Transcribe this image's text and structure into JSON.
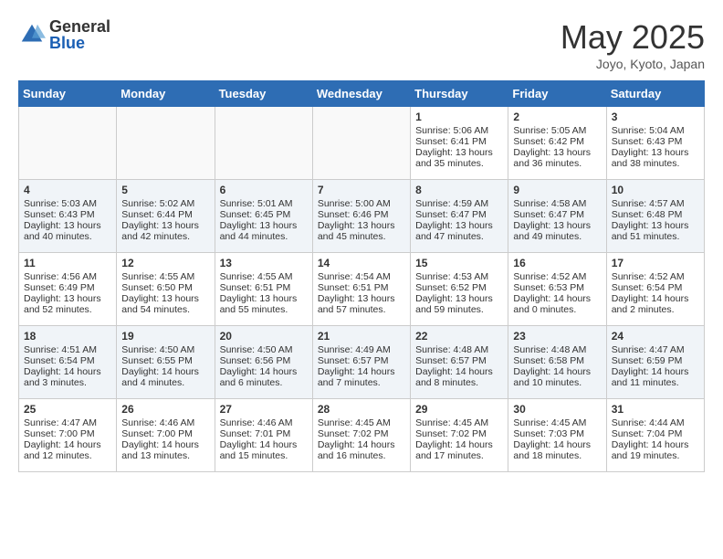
{
  "header": {
    "logo_general": "General",
    "logo_blue": "Blue",
    "month_title": "May 2025",
    "location": "Joyo, Kyoto, Japan"
  },
  "days_of_week": [
    "Sunday",
    "Monday",
    "Tuesday",
    "Wednesday",
    "Thursday",
    "Friday",
    "Saturday"
  ],
  "weeks": [
    [
      {
        "day": "",
        "empty": true
      },
      {
        "day": "",
        "empty": true
      },
      {
        "day": "",
        "empty": true
      },
      {
        "day": "",
        "empty": true
      },
      {
        "day": "1",
        "sunrise": "Sunrise: 5:06 AM",
        "sunset": "Sunset: 6:41 PM",
        "daylight": "Daylight: 13 hours and 35 minutes."
      },
      {
        "day": "2",
        "sunrise": "Sunrise: 5:05 AM",
        "sunset": "Sunset: 6:42 PM",
        "daylight": "Daylight: 13 hours and 36 minutes."
      },
      {
        "day": "3",
        "sunrise": "Sunrise: 5:04 AM",
        "sunset": "Sunset: 6:43 PM",
        "daylight": "Daylight: 13 hours and 38 minutes."
      }
    ],
    [
      {
        "day": "4",
        "sunrise": "Sunrise: 5:03 AM",
        "sunset": "Sunset: 6:43 PM",
        "daylight": "Daylight: 13 hours and 40 minutes."
      },
      {
        "day": "5",
        "sunrise": "Sunrise: 5:02 AM",
        "sunset": "Sunset: 6:44 PM",
        "daylight": "Daylight: 13 hours and 42 minutes."
      },
      {
        "day": "6",
        "sunrise": "Sunrise: 5:01 AM",
        "sunset": "Sunset: 6:45 PM",
        "daylight": "Daylight: 13 hours and 44 minutes."
      },
      {
        "day": "7",
        "sunrise": "Sunrise: 5:00 AM",
        "sunset": "Sunset: 6:46 PM",
        "daylight": "Daylight: 13 hours and 45 minutes."
      },
      {
        "day": "8",
        "sunrise": "Sunrise: 4:59 AM",
        "sunset": "Sunset: 6:47 PM",
        "daylight": "Daylight: 13 hours and 47 minutes."
      },
      {
        "day": "9",
        "sunrise": "Sunrise: 4:58 AM",
        "sunset": "Sunset: 6:47 PM",
        "daylight": "Daylight: 13 hours and 49 minutes."
      },
      {
        "day": "10",
        "sunrise": "Sunrise: 4:57 AM",
        "sunset": "Sunset: 6:48 PM",
        "daylight": "Daylight: 13 hours and 51 minutes."
      }
    ],
    [
      {
        "day": "11",
        "sunrise": "Sunrise: 4:56 AM",
        "sunset": "Sunset: 6:49 PM",
        "daylight": "Daylight: 13 hours and 52 minutes."
      },
      {
        "day": "12",
        "sunrise": "Sunrise: 4:55 AM",
        "sunset": "Sunset: 6:50 PM",
        "daylight": "Daylight: 13 hours and 54 minutes."
      },
      {
        "day": "13",
        "sunrise": "Sunrise: 4:55 AM",
        "sunset": "Sunset: 6:51 PM",
        "daylight": "Daylight: 13 hours and 55 minutes."
      },
      {
        "day": "14",
        "sunrise": "Sunrise: 4:54 AM",
        "sunset": "Sunset: 6:51 PM",
        "daylight": "Daylight: 13 hours and 57 minutes."
      },
      {
        "day": "15",
        "sunrise": "Sunrise: 4:53 AM",
        "sunset": "Sunset: 6:52 PM",
        "daylight": "Daylight: 13 hours and 59 minutes."
      },
      {
        "day": "16",
        "sunrise": "Sunrise: 4:52 AM",
        "sunset": "Sunset: 6:53 PM",
        "daylight": "Daylight: 14 hours and 0 minutes."
      },
      {
        "day": "17",
        "sunrise": "Sunrise: 4:52 AM",
        "sunset": "Sunset: 6:54 PM",
        "daylight": "Daylight: 14 hours and 2 minutes."
      }
    ],
    [
      {
        "day": "18",
        "sunrise": "Sunrise: 4:51 AM",
        "sunset": "Sunset: 6:54 PM",
        "daylight": "Daylight: 14 hours and 3 minutes."
      },
      {
        "day": "19",
        "sunrise": "Sunrise: 4:50 AM",
        "sunset": "Sunset: 6:55 PM",
        "daylight": "Daylight: 14 hours and 4 minutes."
      },
      {
        "day": "20",
        "sunrise": "Sunrise: 4:50 AM",
        "sunset": "Sunset: 6:56 PM",
        "daylight": "Daylight: 14 hours and 6 minutes."
      },
      {
        "day": "21",
        "sunrise": "Sunrise: 4:49 AM",
        "sunset": "Sunset: 6:57 PM",
        "daylight": "Daylight: 14 hours and 7 minutes."
      },
      {
        "day": "22",
        "sunrise": "Sunrise: 4:48 AM",
        "sunset": "Sunset: 6:57 PM",
        "daylight": "Daylight: 14 hours and 8 minutes."
      },
      {
        "day": "23",
        "sunrise": "Sunrise: 4:48 AM",
        "sunset": "Sunset: 6:58 PM",
        "daylight": "Daylight: 14 hours and 10 minutes."
      },
      {
        "day": "24",
        "sunrise": "Sunrise: 4:47 AM",
        "sunset": "Sunset: 6:59 PM",
        "daylight": "Daylight: 14 hours and 11 minutes."
      }
    ],
    [
      {
        "day": "25",
        "sunrise": "Sunrise: 4:47 AM",
        "sunset": "Sunset: 7:00 PM",
        "daylight": "Daylight: 14 hours and 12 minutes."
      },
      {
        "day": "26",
        "sunrise": "Sunrise: 4:46 AM",
        "sunset": "Sunset: 7:00 PM",
        "daylight": "Daylight: 14 hours and 13 minutes."
      },
      {
        "day": "27",
        "sunrise": "Sunrise: 4:46 AM",
        "sunset": "Sunset: 7:01 PM",
        "daylight": "Daylight: 14 hours and 15 minutes."
      },
      {
        "day": "28",
        "sunrise": "Sunrise: 4:45 AM",
        "sunset": "Sunset: 7:02 PM",
        "daylight": "Daylight: 14 hours and 16 minutes."
      },
      {
        "day": "29",
        "sunrise": "Sunrise: 4:45 AM",
        "sunset": "Sunset: 7:02 PM",
        "daylight": "Daylight: 14 hours and 17 minutes."
      },
      {
        "day": "30",
        "sunrise": "Sunrise: 4:45 AM",
        "sunset": "Sunset: 7:03 PM",
        "daylight": "Daylight: 14 hours and 18 minutes."
      },
      {
        "day": "31",
        "sunrise": "Sunrise: 4:44 AM",
        "sunset": "Sunset: 7:04 PM",
        "daylight": "Daylight: 14 hours and 19 minutes."
      }
    ]
  ]
}
